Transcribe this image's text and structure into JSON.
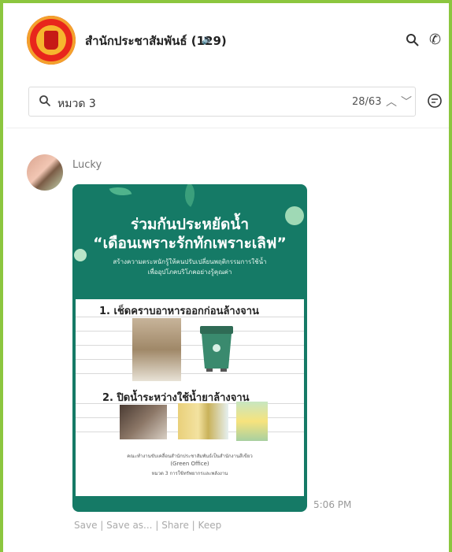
{
  "header": {
    "chat_title": "สำนักประชาสัมพันธ์ (129)"
  },
  "search": {
    "query": "หมวด 3",
    "count": "28/63"
  },
  "message": {
    "sender": "Lucky",
    "time": "5:06 PM",
    "post": {
      "title_line1": "ร่วมกันประหยัดน้ำ",
      "title_line2": "“เดือนเพราะรักทักเพราะเลิฟ”",
      "subtitle_line1": "สร้างความตระหนักรู้ให้คนปรับเปลี่ยนพฤติกรรมการใช้น้ำ",
      "subtitle_line2": "เพื่ออุปโภคบริโภคอย่างรู้คุณค่า",
      "step1": "1. เช็ดคราบอาหารออกก่อนล้างจาน",
      "step2": "2. ปิดน้ำระหว่างใช้น้ำยาล้างจาน",
      "credit_line1": "คณะทำงานขับเคลื่อนสำนักประชาสัมพันธ์เป็นสำนักงานสีเขียว",
      "credit_line2": "(Green Office)",
      "credit_line3": "หมวด 3 การใช้ทรัพยากรและพลังงาน"
    },
    "actions": {
      "save": "Save",
      "save_as": "Save as...",
      "share": "Share",
      "keep": "Keep",
      "separator": "|"
    }
  },
  "colors": {
    "frame_border": "#8cc63f",
    "post_green": "#157a66"
  }
}
